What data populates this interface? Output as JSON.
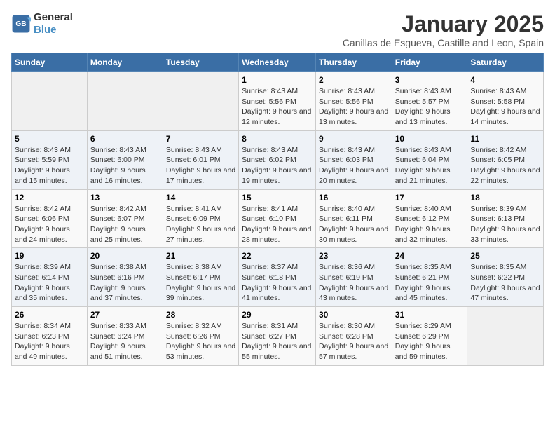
{
  "logo": {
    "line1": "General",
    "line2": "Blue"
  },
  "title": "January 2025",
  "subtitle": "Canillas de Esgueva, Castille and Leon, Spain",
  "weekdays": [
    "Sunday",
    "Monday",
    "Tuesday",
    "Wednesday",
    "Thursday",
    "Friday",
    "Saturday"
  ],
  "weeks": [
    [
      {
        "day": "",
        "info": ""
      },
      {
        "day": "",
        "info": ""
      },
      {
        "day": "",
        "info": ""
      },
      {
        "day": "1",
        "info": "Sunrise: 8:43 AM\nSunset: 5:56 PM\nDaylight: 9 hours and 12 minutes."
      },
      {
        "day": "2",
        "info": "Sunrise: 8:43 AM\nSunset: 5:56 PM\nDaylight: 9 hours and 13 minutes."
      },
      {
        "day": "3",
        "info": "Sunrise: 8:43 AM\nSunset: 5:57 PM\nDaylight: 9 hours and 13 minutes."
      },
      {
        "day": "4",
        "info": "Sunrise: 8:43 AM\nSunset: 5:58 PM\nDaylight: 9 hours and 14 minutes."
      }
    ],
    [
      {
        "day": "5",
        "info": "Sunrise: 8:43 AM\nSunset: 5:59 PM\nDaylight: 9 hours and 15 minutes."
      },
      {
        "day": "6",
        "info": "Sunrise: 8:43 AM\nSunset: 6:00 PM\nDaylight: 9 hours and 16 minutes."
      },
      {
        "day": "7",
        "info": "Sunrise: 8:43 AM\nSunset: 6:01 PM\nDaylight: 9 hours and 17 minutes."
      },
      {
        "day": "8",
        "info": "Sunrise: 8:43 AM\nSunset: 6:02 PM\nDaylight: 9 hours and 19 minutes."
      },
      {
        "day": "9",
        "info": "Sunrise: 8:43 AM\nSunset: 6:03 PM\nDaylight: 9 hours and 20 minutes."
      },
      {
        "day": "10",
        "info": "Sunrise: 8:43 AM\nSunset: 6:04 PM\nDaylight: 9 hours and 21 minutes."
      },
      {
        "day": "11",
        "info": "Sunrise: 8:42 AM\nSunset: 6:05 PM\nDaylight: 9 hours and 22 minutes."
      }
    ],
    [
      {
        "day": "12",
        "info": "Sunrise: 8:42 AM\nSunset: 6:06 PM\nDaylight: 9 hours and 24 minutes."
      },
      {
        "day": "13",
        "info": "Sunrise: 8:42 AM\nSunset: 6:07 PM\nDaylight: 9 hours and 25 minutes."
      },
      {
        "day": "14",
        "info": "Sunrise: 8:41 AM\nSunset: 6:09 PM\nDaylight: 9 hours and 27 minutes."
      },
      {
        "day": "15",
        "info": "Sunrise: 8:41 AM\nSunset: 6:10 PM\nDaylight: 9 hours and 28 minutes."
      },
      {
        "day": "16",
        "info": "Sunrise: 8:40 AM\nSunset: 6:11 PM\nDaylight: 9 hours and 30 minutes."
      },
      {
        "day": "17",
        "info": "Sunrise: 8:40 AM\nSunset: 6:12 PM\nDaylight: 9 hours and 32 minutes."
      },
      {
        "day": "18",
        "info": "Sunrise: 8:39 AM\nSunset: 6:13 PM\nDaylight: 9 hours and 33 minutes."
      }
    ],
    [
      {
        "day": "19",
        "info": "Sunrise: 8:39 AM\nSunset: 6:14 PM\nDaylight: 9 hours and 35 minutes."
      },
      {
        "day": "20",
        "info": "Sunrise: 8:38 AM\nSunset: 6:16 PM\nDaylight: 9 hours and 37 minutes."
      },
      {
        "day": "21",
        "info": "Sunrise: 8:38 AM\nSunset: 6:17 PM\nDaylight: 9 hours and 39 minutes."
      },
      {
        "day": "22",
        "info": "Sunrise: 8:37 AM\nSunset: 6:18 PM\nDaylight: 9 hours and 41 minutes."
      },
      {
        "day": "23",
        "info": "Sunrise: 8:36 AM\nSunset: 6:19 PM\nDaylight: 9 hours and 43 minutes."
      },
      {
        "day": "24",
        "info": "Sunrise: 8:35 AM\nSunset: 6:21 PM\nDaylight: 9 hours and 45 minutes."
      },
      {
        "day": "25",
        "info": "Sunrise: 8:35 AM\nSunset: 6:22 PM\nDaylight: 9 hours and 47 minutes."
      }
    ],
    [
      {
        "day": "26",
        "info": "Sunrise: 8:34 AM\nSunset: 6:23 PM\nDaylight: 9 hours and 49 minutes."
      },
      {
        "day": "27",
        "info": "Sunrise: 8:33 AM\nSunset: 6:24 PM\nDaylight: 9 hours and 51 minutes."
      },
      {
        "day": "28",
        "info": "Sunrise: 8:32 AM\nSunset: 6:26 PM\nDaylight: 9 hours and 53 minutes."
      },
      {
        "day": "29",
        "info": "Sunrise: 8:31 AM\nSunset: 6:27 PM\nDaylight: 9 hours and 55 minutes."
      },
      {
        "day": "30",
        "info": "Sunrise: 8:30 AM\nSunset: 6:28 PM\nDaylight: 9 hours and 57 minutes."
      },
      {
        "day": "31",
        "info": "Sunrise: 8:29 AM\nSunset: 6:29 PM\nDaylight: 9 hours and 59 minutes."
      },
      {
        "day": "",
        "info": ""
      }
    ]
  ]
}
